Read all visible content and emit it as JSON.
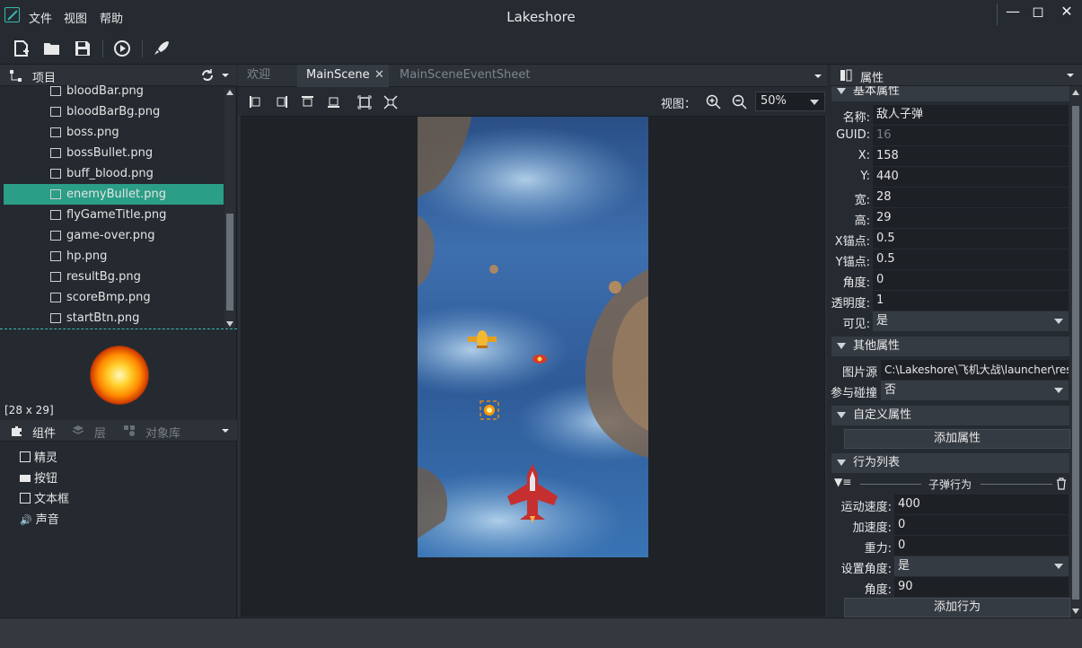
{
  "window": {
    "title": "Lakeshore"
  },
  "menu": {
    "file": "文件",
    "view": "视图",
    "help": "帮助"
  },
  "project_panel": {
    "title": "项目",
    "files": [
      "bloodBar.png",
      "bloodBarBg.png",
      "boss.png",
      "bossBullet.png",
      "buff_blood.png",
      "enemyBullet.png",
      "flyGameTitle.png",
      "game-over.png",
      "hp.png",
      "resultBg.png",
      "scoreBmp.png",
      "startBtn.png"
    ],
    "selected_file": "enemyBullet.png",
    "preview_size": "[28 x 29]"
  },
  "component_panel": {
    "tabs": [
      "组件",
      "层",
      "对象库"
    ],
    "items": [
      "精灵",
      "按钮",
      "文本框",
      "声音"
    ]
  },
  "editor": {
    "tabs": [
      "欢迎",
      "MainScene",
      "MainSceneEventSheet"
    ],
    "active_tab": "MainScene",
    "view_label": "视图：",
    "zoom": "50%"
  },
  "properties": {
    "title": "属性",
    "basic_section": "基本属性",
    "name_label": "名称:",
    "name": "敌人子弹",
    "guid_label": "GUID:",
    "guid": "16",
    "x_label": "X:",
    "x": "158",
    "y_label": "Y:",
    "y": "440",
    "width_label": "宽:",
    "width": "28",
    "height_label": "高:",
    "height": "29",
    "anchor_x_label": "X锚点:",
    "anchor_x": "0.5",
    "anchor_y_label": "Y锚点:",
    "anchor_y": "0.5",
    "angle_label": "角度:",
    "angle": "0",
    "opacity_label": "透明度:",
    "opacity": "1",
    "visible_label": "可见:",
    "visible": "是",
    "other_section": "其他属性",
    "image_source_label": "图片源",
    "image_source": "C:\\Lakeshore\\飞机大战\\launcher\\res",
    "collision_label": "参与碰撞",
    "collision": "否",
    "custom_section": "自定义属性",
    "add_property": "添加属性",
    "behavior_section": "行为列表",
    "behavior_name": "子弹行为",
    "speed_label": "运动速度:",
    "speed": "400",
    "accel_label": "加速度:",
    "accel": "0",
    "gravity_label": "重力:",
    "gravity": "0",
    "set_angle_label": "设置角度:",
    "set_angle": "是",
    "b_angle_label": "角度:",
    "b_angle": "90",
    "add_behavior": "添加行为"
  },
  "colors": {
    "accent": "#2a9e86",
    "bg": "#262b32"
  }
}
